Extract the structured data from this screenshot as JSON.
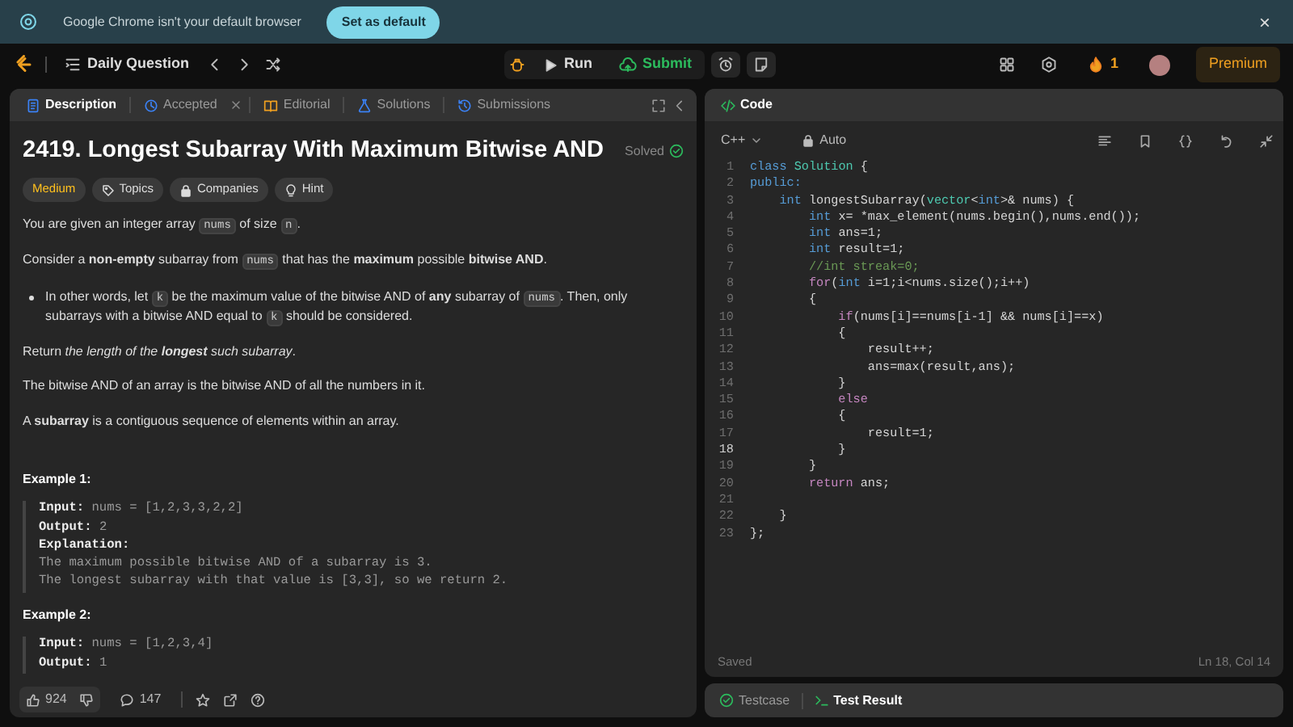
{
  "infobar": {
    "message": "Google Chrome isn't your default browser",
    "button": "Set as default",
    "close": "×"
  },
  "topnav": {
    "list_title": "Daily Question",
    "run": "Run",
    "submit": "Submit",
    "streak": "1",
    "premium": "Premium"
  },
  "left_tabs": [
    {
      "label": "Description",
      "selected": true,
      "kind": "doc",
      "closable": false
    },
    {
      "label": "Accepted",
      "selected": false,
      "kind": "clock",
      "closable": true
    },
    {
      "label": "Editorial",
      "selected": false,
      "kind": "book",
      "closable": false
    },
    {
      "label": "Solutions",
      "selected": false,
      "kind": "flask",
      "closable": false
    },
    {
      "label": "Submissions",
      "selected": false,
      "kind": "history",
      "closable": false
    }
  ],
  "problem": {
    "title": "2419. Longest Subarray With Maximum Bitwise AND",
    "status": "Solved",
    "tags": [
      {
        "label": "Medium",
        "kind": "difficulty"
      },
      {
        "label": "Topics",
        "kind": "tag"
      },
      {
        "label": "Companies",
        "kind": "lock"
      },
      {
        "label": "Hint",
        "kind": "bulb"
      }
    ],
    "paragraphs": [
      {
        "kind": "para",
        "segments": [
          {
            "text": "You are given an integer array ",
            "kind": "text"
          },
          {
            "text": "nums",
            "kind": "code"
          },
          {
            "text": " of size ",
            "kind": "text"
          },
          {
            "text": "n",
            "kind": "code"
          },
          {
            "text": ".",
            "kind": "text"
          }
        ]
      },
      {
        "kind": "para",
        "segments": [
          {
            "text": "Consider a **non-empty** subarray from ",
            "kind": "text"
          },
          {
            "text": "nums",
            "kind": "code"
          },
          {
            "text": " that has the **maximum** possible **bitwise AND**.",
            "kind": "text"
          }
        ]
      },
      {
        "kind": "bullet",
        "segments": [
          {
            "text": "In other words, let ",
            "kind": "text"
          },
          {
            "text": "k",
            "kind": "code"
          },
          {
            "text": " be the maximum value of the bitwise AND of **any** subarray of ",
            "kind": "text"
          },
          {
            "text": "nums",
            "kind": "code"
          },
          {
            "text": ". Then, only subarrays with a bitwise AND equal to ",
            "kind": "text"
          },
          {
            "text": "k",
            "kind": "code"
          },
          {
            "text": " should be considered.",
            "kind": "text"
          }
        ]
      },
      {
        "kind": "para",
        "segments": [
          {
            "text": "Return ",
            "kind": "text"
          },
          {
            "text": "the length of the ",
            "kind": "italic"
          },
          {
            "text": "**longest**",
            "kind": "italic"
          },
          {
            "text": " such subarray",
            "kind": "italic"
          },
          {
            "text": ".",
            "kind": "text"
          }
        ]
      },
      {
        "kind": "para",
        "segments": [
          {
            "text": "The bitwise AND of an array is the bitwise AND of all the numbers in it.",
            "kind": "text"
          }
        ]
      },
      {
        "kind": "para",
        "segments": [
          {
            "text": "A **subarray** is a contiguous sequence of elements within an array.",
            "kind": "text"
          }
        ]
      }
    ],
    "examples": [
      {
        "title": "Example 1:",
        "lines": [
          "**Input:** nums = [1,2,3,3,2,2]",
          "**Output:** 2",
          "**Explanation:**",
          "The maximum possible bitwise AND of a subarray is 3.",
          "The longest subarray with that value is [3,3], so we return 2."
        ]
      },
      {
        "title": "Example 2:",
        "lines": [
          "**Input:** nums = [1,2,3,4]",
          "**Output:** 1"
        ]
      }
    ]
  },
  "left_footer": {
    "likes": "924",
    "comments": "147"
  },
  "code_panel": {
    "title": "Code",
    "language": "C++",
    "mode": "Auto",
    "saved": "Saved",
    "cursor": "Ln 18, Col 14",
    "lines": [
      {
        "number": "1",
        "current": false,
        "tokens": [
          {
            "text": "class",
            "kind": "kw"
          },
          {
            "text": " Solution",
            "kind": "type"
          },
          {
            "text": " {",
            "kind": "plain"
          }
        ]
      },
      {
        "number": "2",
        "current": false,
        "tokens": [
          {
            "text": "public:",
            "kind": "kw"
          }
        ]
      },
      {
        "number": "3",
        "current": false,
        "tokens": [
          {
            "text": "    int",
            "kind": "kw"
          },
          {
            "text": " longestSubarray(",
            "kind": "plain"
          },
          {
            "text": "vector",
            "kind": "type"
          },
          {
            "text": "<",
            "kind": "plain"
          },
          {
            "text": "int",
            "kind": "kw"
          },
          {
            "text": ">& nums) {",
            "kind": "plain"
          }
        ]
      },
      {
        "number": "4",
        "current": false,
        "tokens": [
          {
            "text": "        int",
            "kind": "kw"
          },
          {
            "text": " x= *max_element(nums.begin(),nums.end());",
            "kind": "plain"
          }
        ]
      },
      {
        "number": "5",
        "current": false,
        "tokens": [
          {
            "text": "        int",
            "kind": "kw"
          },
          {
            "text": " ans=1;",
            "kind": "plain"
          }
        ]
      },
      {
        "number": "6",
        "current": false,
        "tokens": [
          {
            "text": "        int",
            "kind": "kw"
          },
          {
            "text": " result=1;",
            "kind": "plain"
          }
        ]
      },
      {
        "number": "7",
        "current": false,
        "tokens": [
          {
            "text": "        //int streak=0;",
            "kind": "comment"
          }
        ]
      },
      {
        "number": "8",
        "current": false,
        "tokens": [
          {
            "text": "        for",
            "kind": "ctrl"
          },
          {
            "text": "(",
            "kind": "plain"
          },
          {
            "text": "int",
            "kind": "kw"
          },
          {
            "text": " i=1;i<nums.size();i++)",
            "kind": "plain"
          }
        ]
      },
      {
        "number": "9",
        "current": false,
        "tokens": [
          {
            "text": "        {",
            "kind": "plain"
          }
        ]
      },
      {
        "number": "10",
        "current": false,
        "tokens": [
          {
            "text": "            if",
            "kind": "ctrl"
          },
          {
            "text": "(nums[i]==nums[i-1] && nums[i]==x)",
            "kind": "plain"
          }
        ]
      },
      {
        "number": "11",
        "current": false,
        "tokens": [
          {
            "text": "            {",
            "kind": "plain"
          }
        ]
      },
      {
        "number": "12",
        "current": false,
        "tokens": [
          {
            "text": "                result++;",
            "kind": "plain"
          }
        ]
      },
      {
        "number": "13",
        "current": false,
        "tokens": [
          {
            "text": "                ans=max(result,ans);",
            "kind": "plain"
          }
        ]
      },
      {
        "number": "14",
        "current": false,
        "tokens": [
          {
            "text": "            }",
            "kind": "plain"
          }
        ]
      },
      {
        "number": "15",
        "current": false,
        "tokens": [
          {
            "text": "            else",
            "kind": "ctrl"
          }
        ]
      },
      {
        "number": "16",
        "current": false,
        "tokens": [
          {
            "text": "            {",
            "kind": "plain"
          }
        ]
      },
      {
        "number": "17",
        "current": false,
        "tokens": [
          {
            "text": "                result=1;",
            "kind": "plain"
          }
        ]
      },
      {
        "number": "18",
        "current": true,
        "tokens": [
          {
            "text": "            }",
            "kind": "plain"
          }
        ]
      },
      {
        "number": "19",
        "current": false,
        "tokens": [
          {
            "text": "        }",
            "kind": "plain"
          }
        ]
      },
      {
        "number": "20",
        "current": false,
        "tokens": [
          {
            "text": "        return",
            "kind": "ctrl"
          },
          {
            "text": " ans;",
            "kind": "plain"
          }
        ]
      },
      {
        "number": "21",
        "current": false
      },
      {
        "number": "22",
        "current": false,
        "tokens": [
          {
            "text": "    }",
            "kind": "plain"
          }
        ]
      },
      {
        "number": "23",
        "current": false,
        "tokens": [
          {
            "text": "};",
            "kind": "plain"
          }
        ]
      }
    ]
  },
  "bottom_tabs": [
    {
      "label": "Testcase",
      "selected": false,
      "kind": "check"
    },
    {
      "label": "Test Result",
      "selected": true,
      "kind": "terminal"
    }
  ]
}
